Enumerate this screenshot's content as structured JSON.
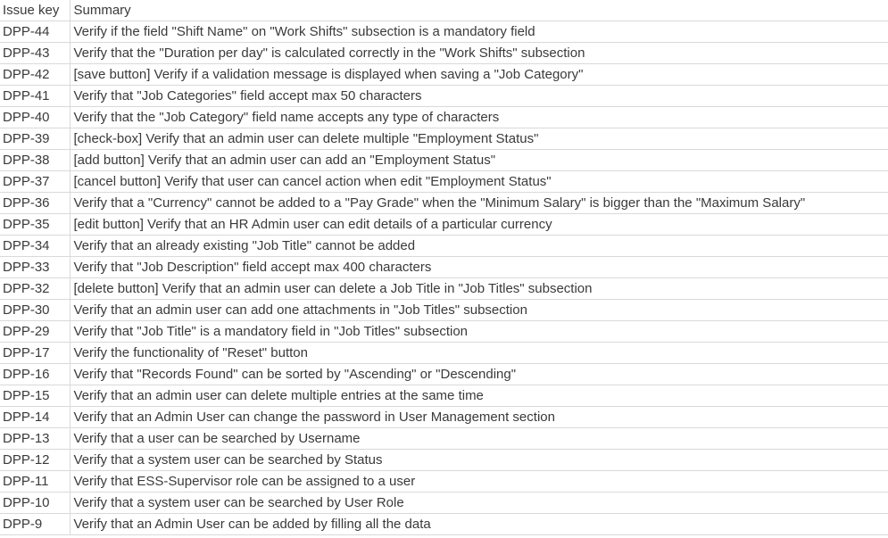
{
  "headers": {
    "issue_key": "Issue key",
    "summary": "Summary"
  },
  "rows": [
    {
      "key": "DPP-44",
      "summary": "Verify if the field \"Shift Name\" on \"Work Shifts\" subsection is a mandatory field"
    },
    {
      "key": "DPP-43",
      "summary": "Verify that the \"Duration per day\" is calculated correctly in the \"Work Shifts\" subsection"
    },
    {
      "key": "DPP-42",
      "summary": "[save button] Verify if a validation message is displayed when saving a \"Job Category\""
    },
    {
      "key": "DPP-41",
      "summary": "Verify that \"Job Categories\" field accept max 50 characters"
    },
    {
      "key": "DPP-40",
      "summary": "Verify that the \"Job Category\" field name accepts any type of characters"
    },
    {
      "key": "DPP-39",
      "summary": "[check-box] Verify that an admin user can delete multiple \"Employment Status\""
    },
    {
      "key": "DPP-38",
      "summary": "[add button] Verify that an admin user can add an \"Employment Status\""
    },
    {
      "key": "DPP-37",
      "summary": "[cancel button] Verify that user can cancel action when edit \"Employment Status\""
    },
    {
      "key": "DPP-36",
      "summary": "Verify that a \"Currency\" cannot be added to a \"Pay Grade\" when the \"Minimum Salary\" is bigger than the \"Maximum Salary\""
    },
    {
      "key": "DPP-35",
      "summary": "[edit button] Verify that an HR Admin user can edit details of a particular currency"
    },
    {
      "key": "DPP-34",
      "summary": "Verify that an already existing \"Job Title\" cannot be added"
    },
    {
      "key": "DPP-33",
      "summary": "Verify that \"Job Description\" field accept max 400 characters"
    },
    {
      "key": "DPP-32",
      "summary": "[delete button] Verify that an admin user can delete a Job Title in \"Job Titles\" subsection"
    },
    {
      "key": "DPP-30",
      "summary": "Verify that an admin user can add one attachments in \"Job Titles\" subsection"
    },
    {
      "key": "DPP-29",
      "summary": "Verify that \"Job Title\" is a mandatory field in \"Job Titles\" subsection"
    },
    {
      "key": "DPP-17",
      "summary": "Verify the functionality of \"Reset\" button"
    },
    {
      "key": "DPP-16",
      "summary": "Verify that \"Records Found\" can be sorted by \"Ascending\" or \"Descending\""
    },
    {
      "key": "DPP-15",
      "summary": "Verify that an admin user can delete multiple entries at the same time"
    },
    {
      "key": "DPP-14",
      "summary": "Verify that an Admin User can change the password in User Management section"
    },
    {
      "key": "DPP-13",
      "summary": "Verify that a user can be searched by Username"
    },
    {
      "key": "DPP-12",
      "summary": "Verify that a system user can be searched by Status"
    },
    {
      "key": "DPP-11",
      "summary": "Verify that ESS-Supervisor role can be assigned to a user"
    },
    {
      "key": "DPP-10",
      "summary": "Verify that a system user can be searched by User Role"
    },
    {
      "key": "DPP-9",
      "summary": "Verify that an Admin User can be added by filling all the data"
    }
  ],
  "colors": {
    "gridline": "#d9d9d9",
    "text": "#3a3a3a",
    "background": "#ffffff"
  }
}
